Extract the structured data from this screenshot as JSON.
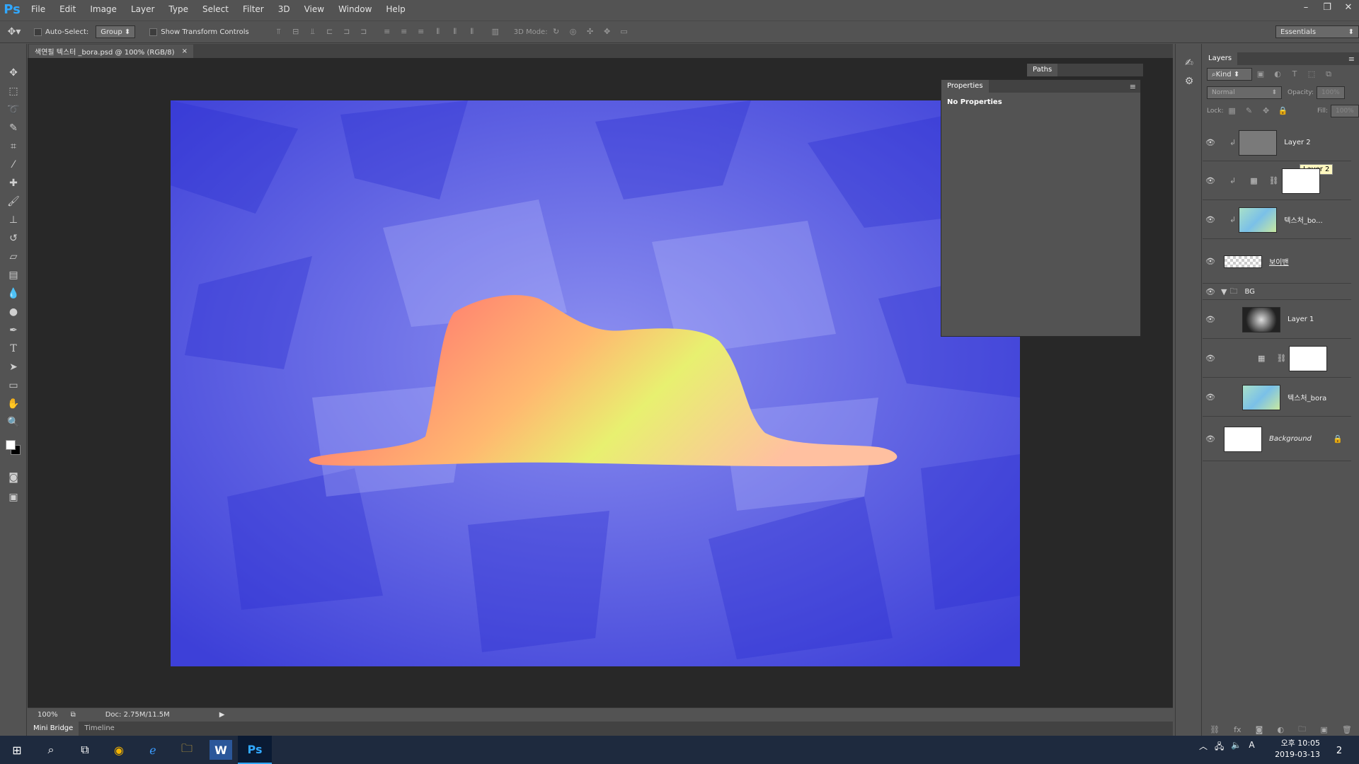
{
  "app": {
    "logo": "Ps"
  },
  "menu": [
    "File",
    "Edit",
    "Image",
    "Layer",
    "Type",
    "Select",
    "Filter",
    "3D",
    "View",
    "Window",
    "Help"
  ],
  "options": {
    "auto_select": "Auto-Select:",
    "group": "Group",
    "show_transform": "Show Transform Controls",
    "mode3d": "3D Mode:",
    "workspace": "Essentials"
  },
  "document": {
    "tab_title": "색연필 텍스터 _bora.psd @ 100% (RGB/8)",
    "zoom": "100%",
    "doc_size": "Doc: 2.75M/11.5M"
  },
  "bottom_tabs": [
    "Mini Bridge",
    "Timeline"
  ],
  "paths": {
    "tab": "Paths"
  },
  "properties": {
    "title": "Properties",
    "content": "No Properties"
  },
  "layers": {
    "tab": "Layers",
    "filter": "Kind",
    "blend": "Normal",
    "opacity_label": "Opacity:",
    "opacity": "100%",
    "lock_label": "Lock:",
    "fill_label": "Fill:",
    "fill": "100%",
    "tooltip": "Layer 2",
    "items": [
      {
        "name": "Layer 2"
      },
      {
        "name": ""
      },
      {
        "name": "텍스처_bo..."
      },
      {
        "name": "보이밴"
      },
      {
        "name": "BG"
      },
      {
        "name": "Layer 1"
      },
      {
        "name": ""
      },
      {
        "name": "텍스처_bora"
      },
      {
        "name": "Background"
      }
    ]
  },
  "taskbar": {
    "time": "오후 10:05",
    "date": "2019-03-13",
    "notification_count": "2",
    "ime": "A"
  },
  "colors": {
    "accent": "#31a8ff",
    "canvas_bg": "#5a5ee0",
    "panel_bg": "#535353",
    "taskbar_bg": "#1e2a3e"
  }
}
